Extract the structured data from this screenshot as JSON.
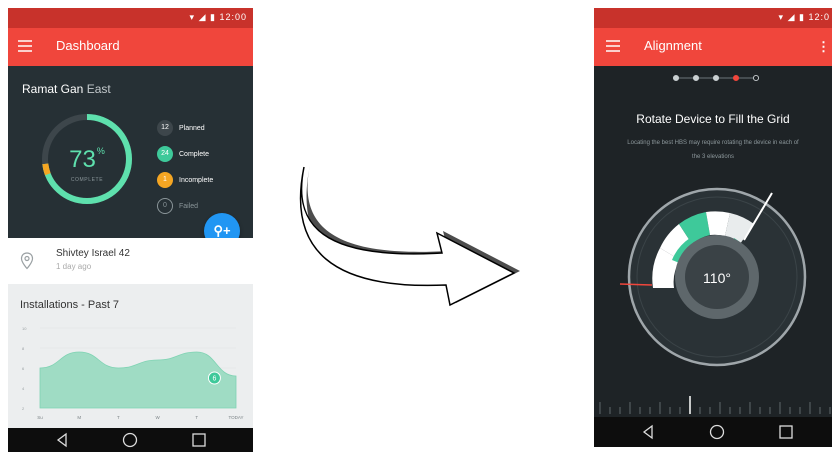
{
  "left_phone": {
    "status_time": "12:00",
    "title": "Dashboard",
    "region": {
      "name": "Ramat Gan",
      "sub": "East"
    },
    "progress": {
      "value": "73",
      "unit": "%",
      "label": "COMPLETE",
      "fraction": 0.73
    },
    "legend": [
      {
        "count": "12",
        "label": "Planned",
        "color": "#3d464b"
      },
      {
        "count": "24",
        "label": "Complete",
        "color": "#3ec99a"
      },
      {
        "count": "1",
        "label": "Incomplete",
        "color": "#f5a623"
      },
      {
        "count": "0",
        "label": "Failed",
        "color": "#263035"
      }
    ],
    "fab_icon": "add-location-icon",
    "recent": {
      "name": "Shivtey Israel 42",
      "time": "1 day ago"
    },
    "chart_title": "Installations - Past 7"
  },
  "chart_data": {
    "type": "area",
    "title": "Installations - Past 7",
    "categories": [
      "Su",
      "M",
      "T",
      "W",
      "T",
      "TODAY"
    ],
    "values": [
      5,
      7,
      5,
      6,
      7,
      4
    ],
    "ylim": [
      0,
      10
    ],
    "yticks": [
      "10",
      "8",
      "6",
      "4",
      "2"
    ],
    "highlight": {
      "label": "6",
      "color": "#3ec99a"
    },
    "fill_color": "#9fdcc4"
  },
  "right_phone": {
    "status_time": "12:0",
    "title": "Alignment",
    "heading": "Rotate Device to Fill the Grid",
    "subtext": "Locating the best HBS may require rotating the device in each of the 3 elevations",
    "angle": "110°",
    "steps_total": 5,
    "active_step": 4
  },
  "colors": {
    "accent_red": "#f0463c",
    "teal": "#3ec99a",
    "orange": "#f5a623",
    "blue": "#2196f3"
  }
}
